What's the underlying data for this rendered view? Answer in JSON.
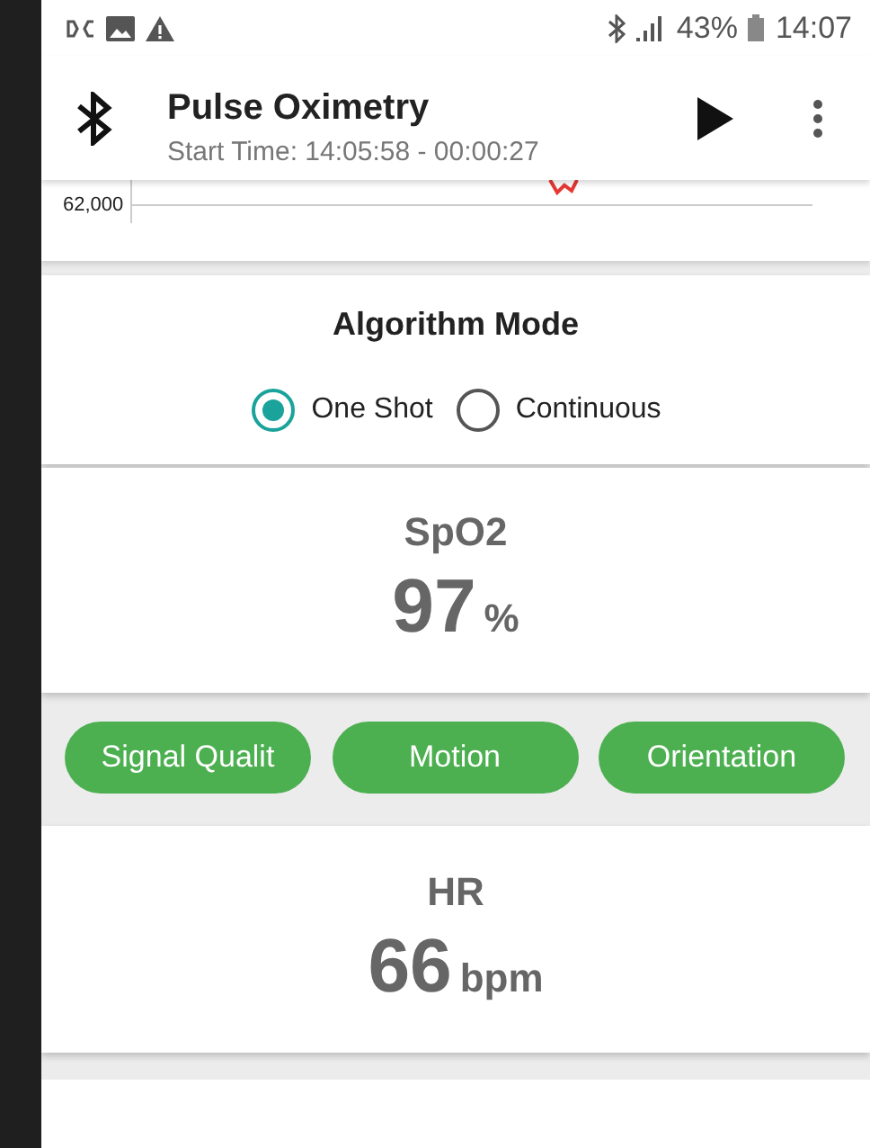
{
  "status_bar": {
    "battery": "43%",
    "time": "14:07"
  },
  "toolbar": {
    "title": "Pulse Oximetry",
    "subtitle": "Start Time: 14:05:58 - 00:00:27"
  },
  "chart": {
    "y_label": "62,000"
  },
  "algorithm_mode": {
    "title": "Algorithm Mode",
    "options": [
      {
        "label": "One Shot",
        "selected": true
      },
      {
        "label": "Continuous",
        "selected": false
      }
    ]
  },
  "spo2": {
    "title": "SpO2",
    "value": "97",
    "unit": "%"
  },
  "buttons": [
    "Signal Qualit",
    "Motion",
    "Orientation"
  ],
  "hr": {
    "title": "HR",
    "value": "66",
    "unit": "bpm"
  }
}
